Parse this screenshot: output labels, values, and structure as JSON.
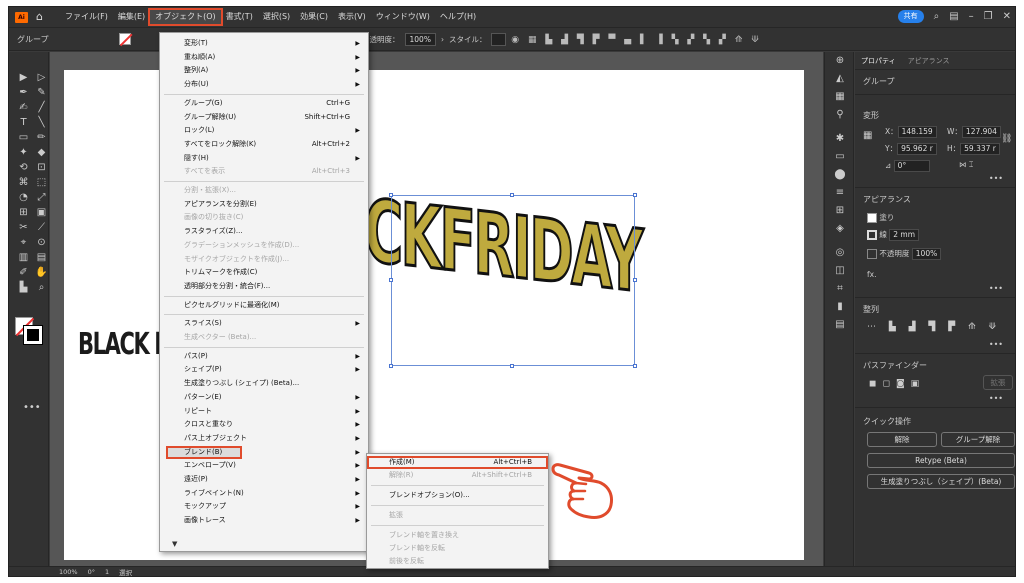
{
  "menubar": {
    "logo": "Ai",
    "items": [
      "ファイル(F)",
      "編集(E)",
      "オブジェクト(O)",
      "書式(T)",
      "選択(S)",
      "効果(C)",
      "表示(V)",
      "ウィンドウ(W)",
      "ヘルプ(H)"
    ],
    "active_index": 2,
    "share_label": "共有"
  },
  "control_bar": {
    "selection_label": "グループ",
    "opacity_label": "不透明度：",
    "opacity_value": "100%",
    "style_label": "スタイル："
  },
  "object_menu": {
    "items": [
      {
        "label": "変形(T)",
        "submenu": true
      },
      {
        "label": "重ね順(A)",
        "submenu": true
      },
      {
        "label": "整列(A)",
        "submenu": true
      },
      {
        "label": "分布(U)",
        "submenu": true
      },
      {
        "sep": true
      },
      {
        "label": "グループ(G)",
        "shortcut": "Ctrl+G"
      },
      {
        "label": "グループ解除(U)",
        "shortcut": "Shift+Ctrl+G"
      },
      {
        "label": "ロック(L)",
        "submenu": true
      },
      {
        "label": "すべてをロック解除(K)",
        "shortcut": "Alt+Ctrl+2"
      },
      {
        "label": "隠す(H)",
        "submenu": true
      },
      {
        "label": "すべてを表示",
        "shortcut": "Alt+Ctrl+3",
        "disabled": true
      },
      {
        "sep": true
      },
      {
        "label": "分割・拡張(X)...",
        "disabled": true
      },
      {
        "label": "アピアランスを分割(E)"
      },
      {
        "label": "画像の切り抜き(C)",
        "disabled": true
      },
      {
        "label": "ラスタライズ(Z)..."
      },
      {
        "label": "グラデーションメッシュを作成(D)...",
        "disabled": true
      },
      {
        "label": "モザイクオブジェクトを作成(J)...",
        "disabled": true
      },
      {
        "label": "トリムマークを作成(C)"
      },
      {
        "label": "透明部分を分割・統合(F)..."
      },
      {
        "sep": true
      },
      {
        "label": "ピクセルグリッドに最適化(M)"
      },
      {
        "sep": true
      },
      {
        "label": "スライス(S)",
        "submenu": true
      },
      {
        "label": "生成ベクター (Beta)...",
        "disabled": true
      },
      {
        "sep": true
      },
      {
        "label": "パス(P)",
        "submenu": true
      },
      {
        "label": "シェイプ(P)",
        "submenu": true
      },
      {
        "label": "生成塗りつぶし (シェイプ) (Beta)..."
      },
      {
        "label": "パターン(E)",
        "submenu": true
      },
      {
        "label": "リピート",
        "submenu": true
      },
      {
        "label": "クロスと重なり",
        "submenu": true
      },
      {
        "label": "パス上オブジェクト",
        "submenu": true
      },
      {
        "label": "ブレンド(B)",
        "submenu": true,
        "highlight": true
      },
      {
        "label": "エンベロープ(V)",
        "submenu": true
      },
      {
        "label": "遠近(P)",
        "submenu": true
      },
      {
        "label": "ライブペイント(N)",
        "submenu": true
      },
      {
        "label": "モックアップ",
        "submenu": true
      },
      {
        "label": "画像トレース",
        "submenu": true
      }
    ]
  },
  "blend_submenu": {
    "items": [
      {
        "label": "作成(M)",
        "shortcut": "Alt+Ctrl+B",
        "highlight": true
      },
      {
        "label": "解除(R)",
        "shortcut": "Alt+Shift+Ctrl+B",
        "disabled": true
      },
      {
        "sep": true
      },
      {
        "label": "ブレンドオプション(O)..."
      },
      {
        "sep": true
      },
      {
        "label": "拡張",
        "disabled": true
      },
      {
        "sep": true
      },
      {
        "label": "ブレンド軸を置き換え",
        "disabled": true
      },
      {
        "label": "ブレンド軸を反転",
        "disabled": true
      },
      {
        "label": "前後を反転",
        "disabled": true
      }
    ]
  },
  "artwork": {
    "main_text": "CKFRIDAY",
    "back_text": "BLACK FRIDAY",
    "fill_color": "#bfaa3e"
  },
  "properties_panel": {
    "tabs": [
      "プロパティ",
      "アピアランス"
    ],
    "active_tab": 0,
    "selection": "グループ",
    "transform_title": "変形",
    "x_label": "X：",
    "x_value": "148.159",
    "y_label": "Y：",
    "y_value": "95.962 r",
    "w_label": "W：",
    "w_value": "127.904",
    "h_label": "H：",
    "h_value": "59.337 r",
    "angle_value": "0°",
    "appearance_title": "アピアランス",
    "fill_label": "塗り",
    "stroke_label": "線",
    "stroke_value": "2 mm",
    "opacity_label": "不透明度",
    "opacity_value": "100%",
    "fx_label": "fx.",
    "align_title": "整列",
    "pathfinder_title": "パスファインダー",
    "pathfinder_expand": "拡張",
    "quick_title": "クイック操作",
    "btn_ungroup_1": "解除",
    "btn_ungroup_2": "グループ解除",
    "btn_retype": "Retype (Beta)",
    "btn_gen_fill": "生成塗りつぶし（シェイプ）(Beta)"
  },
  "status_bar": {
    "zoom": "100%",
    "angle": "0°",
    "page": "1",
    "mode": "選択"
  },
  "colors": {
    "highlight_outline": "#e04b2c",
    "share_blue": "#2680eb"
  }
}
